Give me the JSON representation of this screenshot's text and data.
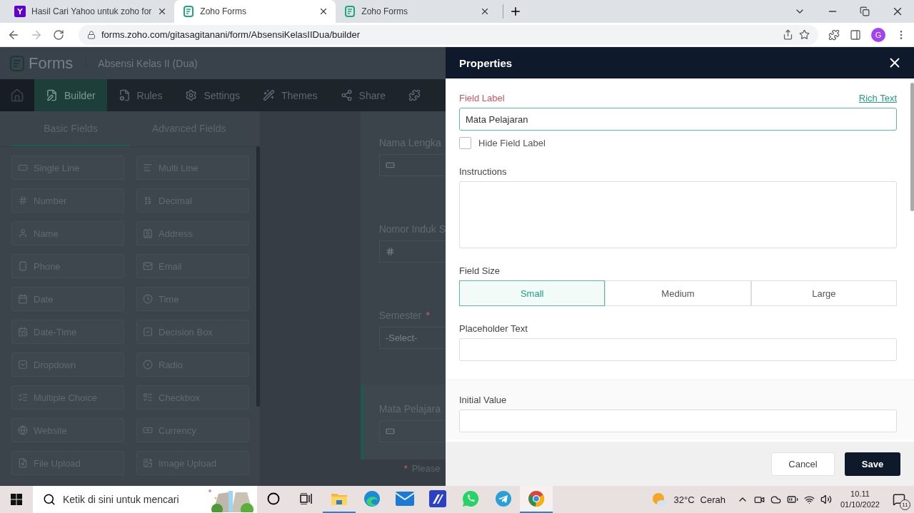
{
  "browser": {
    "tabs": [
      {
        "title": "Hasil Cari Yahoo untuk zoho for",
        "kind": "yahoo",
        "selected": false
      },
      {
        "title": "Zoho Forms",
        "kind": "forms",
        "selected": true
      },
      {
        "title": "Zoho Forms",
        "kind": "forms",
        "selected": false
      }
    ],
    "url": "forms.zoho.com/gitasagitanani/form/AbsensiKelasIIDua/builder",
    "avatar": "G"
  },
  "app": {
    "logo": "Forms",
    "form_name": "Absensi Kelas II (Dua)",
    "nav": [
      {
        "label": "Builder",
        "kind": "builder",
        "selected": true
      },
      {
        "label": "Rules",
        "kind": "rules",
        "selected": false
      },
      {
        "label": "Settings",
        "kind": "settings",
        "selected": false
      },
      {
        "label": "Themes",
        "kind": "themes",
        "selected": false
      },
      {
        "label": "Share",
        "kind": "share",
        "selected": false
      }
    ],
    "field_tabs": [
      {
        "label": "Basic Fields",
        "selected": true
      },
      {
        "label": "Advanced Fields",
        "selected": false
      }
    ],
    "field_types": [
      {
        "label": "Single Line",
        "kind": "single"
      },
      {
        "label": "Multi Line",
        "kind": "multi"
      },
      {
        "label": "Number",
        "kind": "number"
      },
      {
        "label": "Decimal",
        "kind": "decimal"
      },
      {
        "label": "Name",
        "kind": "name"
      },
      {
        "label": "Address",
        "kind": "address"
      },
      {
        "label": "Phone",
        "kind": "phone"
      },
      {
        "label": "Email",
        "kind": "email"
      },
      {
        "label": "Date",
        "kind": "date"
      },
      {
        "label": "Time",
        "kind": "time"
      },
      {
        "label": "Date-Time",
        "kind": "datetime"
      },
      {
        "label": "Decision Box",
        "kind": "decision"
      },
      {
        "label": "Dropdown",
        "kind": "dropdown"
      },
      {
        "label": "Radio",
        "kind": "radio"
      },
      {
        "label": "Multiple Choice",
        "kind": "multiple"
      },
      {
        "label": "Checkbox",
        "kind": "checkbox"
      },
      {
        "label": "Website",
        "kind": "website"
      },
      {
        "label": "Currency",
        "kind": "currency"
      },
      {
        "label": "File Upload",
        "kind": "file"
      },
      {
        "label": "Image Upload",
        "kind": "image"
      }
    ],
    "form_fields": [
      {
        "label": "Nama Lengka",
        "kind": "text",
        "required": false,
        "selected": false
      },
      {
        "label": "Nomor Induk S",
        "kind": "number",
        "required": false,
        "selected": false
      },
      {
        "label": "Semester",
        "kind": "select",
        "value": "-Select-",
        "required": true,
        "selected": false
      },
      {
        "label": "Mata Pelajara",
        "kind": "text",
        "required": false,
        "selected": true
      }
    ],
    "form_note": {
      "mark": "*",
      "text": "Please"
    }
  },
  "properties": {
    "title": "Properties",
    "field_label": {
      "label": "Field Label",
      "link": "Rich Text",
      "value": "Mata Pelajaran"
    },
    "hide_label": {
      "label": "Hide Field Label",
      "checked": false
    },
    "instructions": {
      "label": "Instructions"
    },
    "field_size": {
      "label": "Field Size",
      "options": [
        {
          "label": "Small",
          "selected": true
        },
        {
          "label": "Medium",
          "selected": false
        },
        {
          "label": "Large",
          "selected": false
        }
      ]
    },
    "placeholder_text": {
      "label": "Placeholder Text"
    },
    "initial_value": {
      "label": "Initial Value"
    },
    "cancel": "Cancel",
    "save": "Save"
  },
  "taskbar": {
    "search_placeholder": "Ketik di sini untuk mencari",
    "apps": [
      {
        "kind": "explorer",
        "running": true,
        "selected": false
      },
      {
        "kind": "edge",
        "running": false,
        "selected": false
      },
      {
        "kind": "mail",
        "running": false,
        "selected": false
      },
      {
        "kind": "notes",
        "running": false,
        "selected": false
      },
      {
        "kind": "whatsapp",
        "running": false,
        "selected": false
      },
      {
        "kind": "telegram",
        "running": false,
        "selected": false
      },
      {
        "kind": "chrome",
        "running": true,
        "selected": true
      }
    ],
    "weather": {
      "temp": "32°C",
      "condition": "Cerah"
    },
    "time": "10.11",
    "date": "01/10/2022",
    "notifications": "11"
  }
}
